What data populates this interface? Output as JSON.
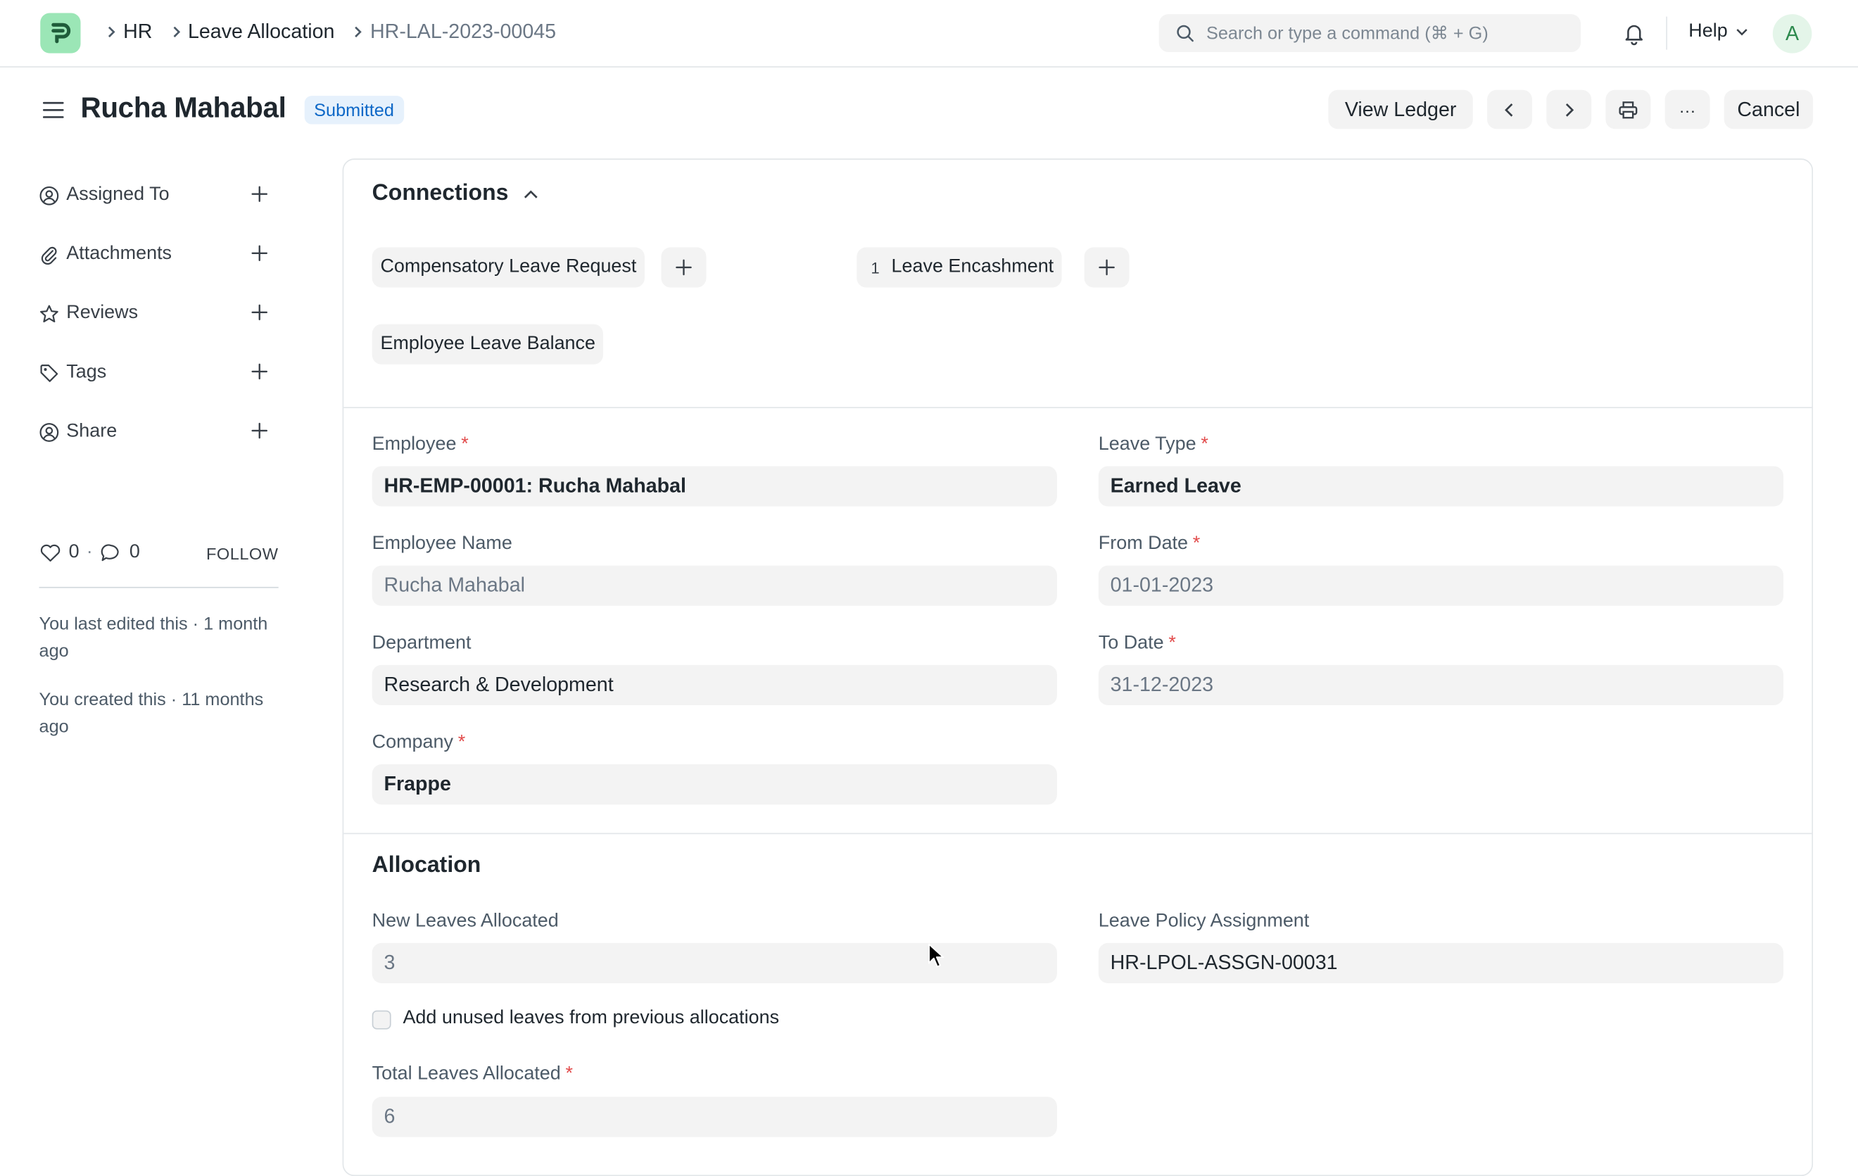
{
  "navbar": {
    "breadcrumbs": [
      "HR",
      "Leave Allocation",
      "HR-LAL-2023-00045"
    ],
    "search_placeholder": "Search or type a command (⌘ + G)",
    "help_label": "Help",
    "avatar_initial": "A"
  },
  "page": {
    "title": "Rucha Mahabal",
    "status": "Submitted",
    "view_ledger_label": "View Ledger",
    "more_label": "···",
    "cancel_label": "Cancel"
  },
  "sidebar": {
    "items": [
      {
        "label": "Assigned To",
        "icon": "user-circle-icon"
      },
      {
        "label": "Attachments",
        "icon": "paperclip-icon"
      },
      {
        "label": "Reviews",
        "icon": "star-icon"
      },
      {
        "label": "Tags",
        "icon": "tag-icon"
      },
      {
        "label": "Share",
        "icon": "share-user-icon"
      }
    ],
    "likes": "0",
    "comments": "0",
    "separator": "·",
    "follow_label": "FOLLOW",
    "last_edited": "You last edited this · 1 month ago",
    "created": "You created this · 11 months ago"
  },
  "connections": {
    "title": "Connections",
    "items": [
      {
        "label": "Compensatory Leave Request",
        "count": ""
      },
      {
        "label": "Leave Encashment",
        "count": "1"
      },
      {
        "label": "Employee Leave Balance",
        "count": ""
      }
    ]
  },
  "details": {
    "employee": {
      "label": "Employee",
      "value": "HR-EMP-00001: Rucha Mahabal"
    },
    "employee_name": {
      "label": "Employee Name",
      "value": "Rucha Mahabal"
    },
    "department": {
      "label": "Department",
      "value": "Research & Development"
    },
    "company": {
      "label": "Company",
      "value": "Frappe"
    },
    "leave_type": {
      "label": "Leave Type",
      "value": "Earned Leave"
    },
    "from_date": {
      "label": "From Date",
      "value": "01-01-2023"
    },
    "to_date": {
      "label": "To Date",
      "value": "31-12-2023"
    },
    "required_mark": "*"
  },
  "allocation": {
    "title": "Allocation",
    "new_leaves": {
      "label": "New Leaves Allocated",
      "value": "3"
    },
    "policy": {
      "label": "Leave Policy Assignment",
      "value": "HR-LPOL-ASSGN-00031"
    },
    "carry_forward_label": "Add unused leaves from previous allocations",
    "total_leaves": {
      "label": "Total Leaves Allocated",
      "value": "6"
    }
  },
  "colors": {
    "accent": "#0e68c7",
    "badge_bg": "#e6f1fc",
    "logo_bg": "#9be6b6",
    "required": "#e24c4c"
  }
}
